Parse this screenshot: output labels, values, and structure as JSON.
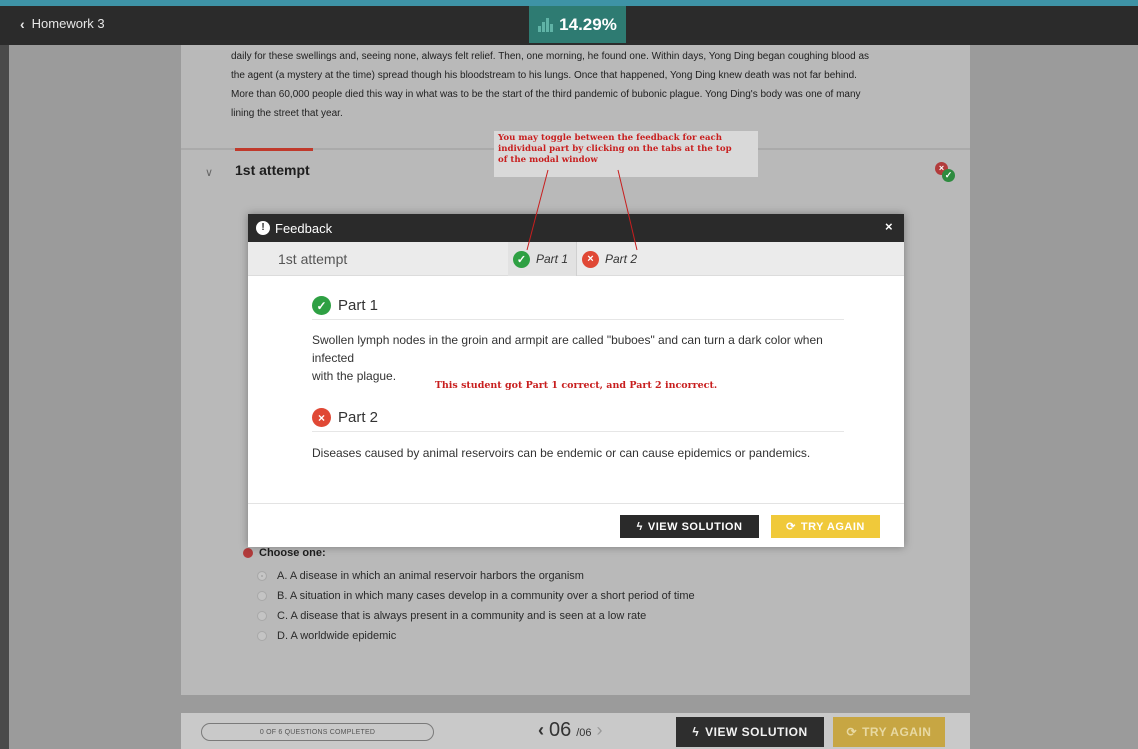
{
  "topbar": {
    "back_label": "Homework 3",
    "score": "14.29%"
  },
  "passage": {
    "lines": [
      "daily for these swellings and, seeing none, always felt relief. Then, one morning, he found one. Within days, Yong Ding began coughing blood as",
      "the agent (a mystery at the time) spread though his bloodstream to his lungs. Once that happened, Yong Ding knew death was not far behind.",
      "More than 60,000 people died this way in what was to be the start of the third pandemic of bubonic plague. Yong Ding's body was one of many",
      "lining the street that year."
    ]
  },
  "attempt_row": {
    "title": "1st attempt"
  },
  "annotation": {
    "lines": [
      "You may toggle between the feedback for each",
      "individual part by clicking on the tabs at the top",
      " of the modal window"
    ]
  },
  "modal": {
    "title": "Feedback",
    "close": "×",
    "attempt_label": "1st attempt",
    "tabs": [
      {
        "label": "Part 1",
        "status": "correct"
      },
      {
        "label": "Part 2",
        "status": "incorrect"
      }
    ],
    "parts": [
      {
        "heading": "Part 1",
        "status": "correct",
        "lines": [
          "Swollen lymph nodes in the groin and armpit are called \"buboes\" and can turn a dark color when infected",
          "with the plague."
        ]
      },
      {
        "heading": "Part 2",
        "status": "incorrect",
        "lines": [
          "Diseases caused by animal reservoirs can be endemic or can cause epidemics or pandemics."
        ]
      }
    ],
    "verdict_note": "This student got Part 1 correct, and Part 2 incorrect.",
    "view_solution_label": "VIEW SOLUTION",
    "try_again_label": "TRY AGAIN"
  },
  "question": {
    "prompt_partial": "Choose one:",
    "options": [
      {
        "label": "A. A disease in which an animal reservoir harbors the organism",
        "selected": true
      },
      {
        "label": "B. A situation in which many cases develop in a community over a short period of time",
        "selected": false
      },
      {
        "label": "C. A disease that is always present in a community and is seen at a low rate",
        "selected": false
      },
      {
        "label": "D. A worldwide epidemic",
        "selected": false
      }
    ]
  },
  "bottombar": {
    "progress_label": "0 OF 6 QUESTIONS COMPLETED",
    "page_current": "06",
    "page_total": "/06",
    "view_solution_label": "VIEW SOLUTION",
    "try_again_label": "TRY AGAIN"
  },
  "colors": {
    "accent_teal": "#2e7b72",
    "correct_green": "#2ea043",
    "incorrect_red": "#e04835",
    "try_again_yellow": "#f0c93a",
    "annotation_red": "#c81e1e"
  },
  "icons": {
    "back": "chevron-left-icon",
    "score": "bar-chart-icon",
    "info": "exclamation-circle-icon",
    "close": "close-icon",
    "correct": "check-circle-icon",
    "incorrect": "x-circle-icon",
    "view_solution": "lightning-bolt-icon",
    "try_again": "refresh-icon"
  }
}
